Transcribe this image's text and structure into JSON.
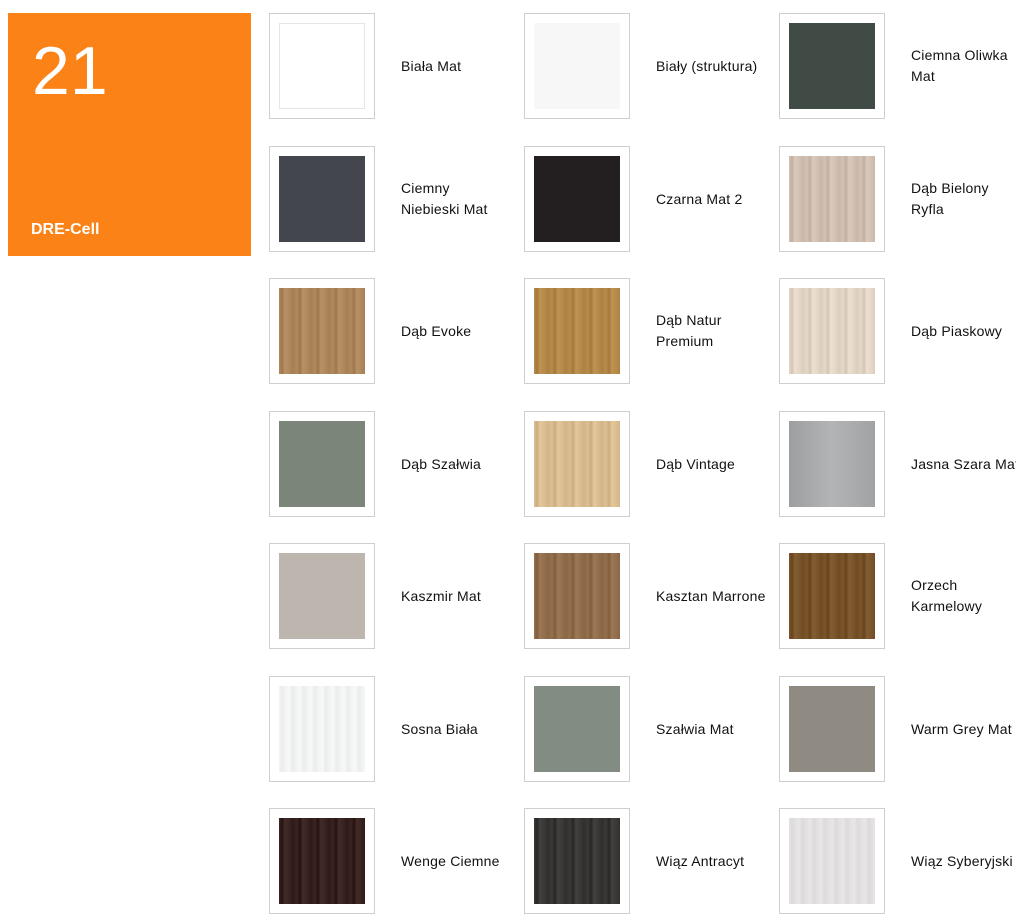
{
  "badge": {
    "number": "21",
    "name": "DRE-Cell",
    "color": "#fb8217"
  },
  "swatches": [
    {
      "label": "Biała Mat",
      "color": "#ffffff",
      "pattern": "plain-outline"
    },
    {
      "label": "Biały (struktura)",
      "color": "#f7f7f7",
      "pattern": "plain"
    },
    {
      "label": "Ciemna Oliwka Mat",
      "color": "#3f4b44",
      "pattern": "plain"
    },
    {
      "label": "Ciemny Niebieski Mat",
      "color": "#43464d",
      "pattern": "plain"
    },
    {
      "label": "Czarna Mat 2",
      "color": "#231f20",
      "pattern": "plain"
    },
    {
      "label": "Dąb Bielony Ryfla",
      "color": "#d3c2b3",
      "pattern": "wood"
    },
    {
      "label": "Dąb Evoke",
      "color": "#b08a5e",
      "pattern": "wood"
    },
    {
      "label": "Dąb Natur Premium",
      "color": "#b78b4b",
      "pattern": "wood"
    },
    {
      "label": "Dąb Piaskowy",
      "color": "#e5d8c8",
      "pattern": "wood"
    },
    {
      "label": "Dąb Szałwia",
      "color": "#7b857a",
      "pattern": "plain"
    },
    {
      "label": "Dąb Vintage",
      "color": "#dcbf92",
      "pattern": "wood"
    },
    {
      "label": "Jasna Szara Mat",
      "color": "#a6a8aa",
      "pattern": "gradient"
    },
    {
      "label": "Kaszmir Mat",
      "color": "#bcb6ae",
      "pattern": "plain"
    },
    {
      "label": "Kasztan Marrone",
      "color": "#94704f",
      "pattern": "wood"
    },
    {
      "label": "Orzech Karmelowy",
      "color": "#7b552c",
      "pattern": "wood"
    },
    {
      "label": "Sosna Biała",
      "color": "#f3f5f5",
      "pattern": "wood-light"
    },
    {
      "label": "Szałwia Mat",
      "color": "#838c83",
      "pattern": "plain"
    },
    {
      "label": "Warm Grey Mat",
      "color": "#8f8a82",
      "pattern": "plain"
    },
    {
      "label": "Wenge Ciemne",
      "color": "#3a2422",
      "pattern": "wood"
    },
    {
      "label": "Wiąz Antracyt",
      "color": "#3b3937",
      "pattern": "wood"
    },
    {
      "label": "Wiąz Syberyjski",
      "color": "#e4e2e2",
      "pattern": "wood-light"
    }
  ]
}
